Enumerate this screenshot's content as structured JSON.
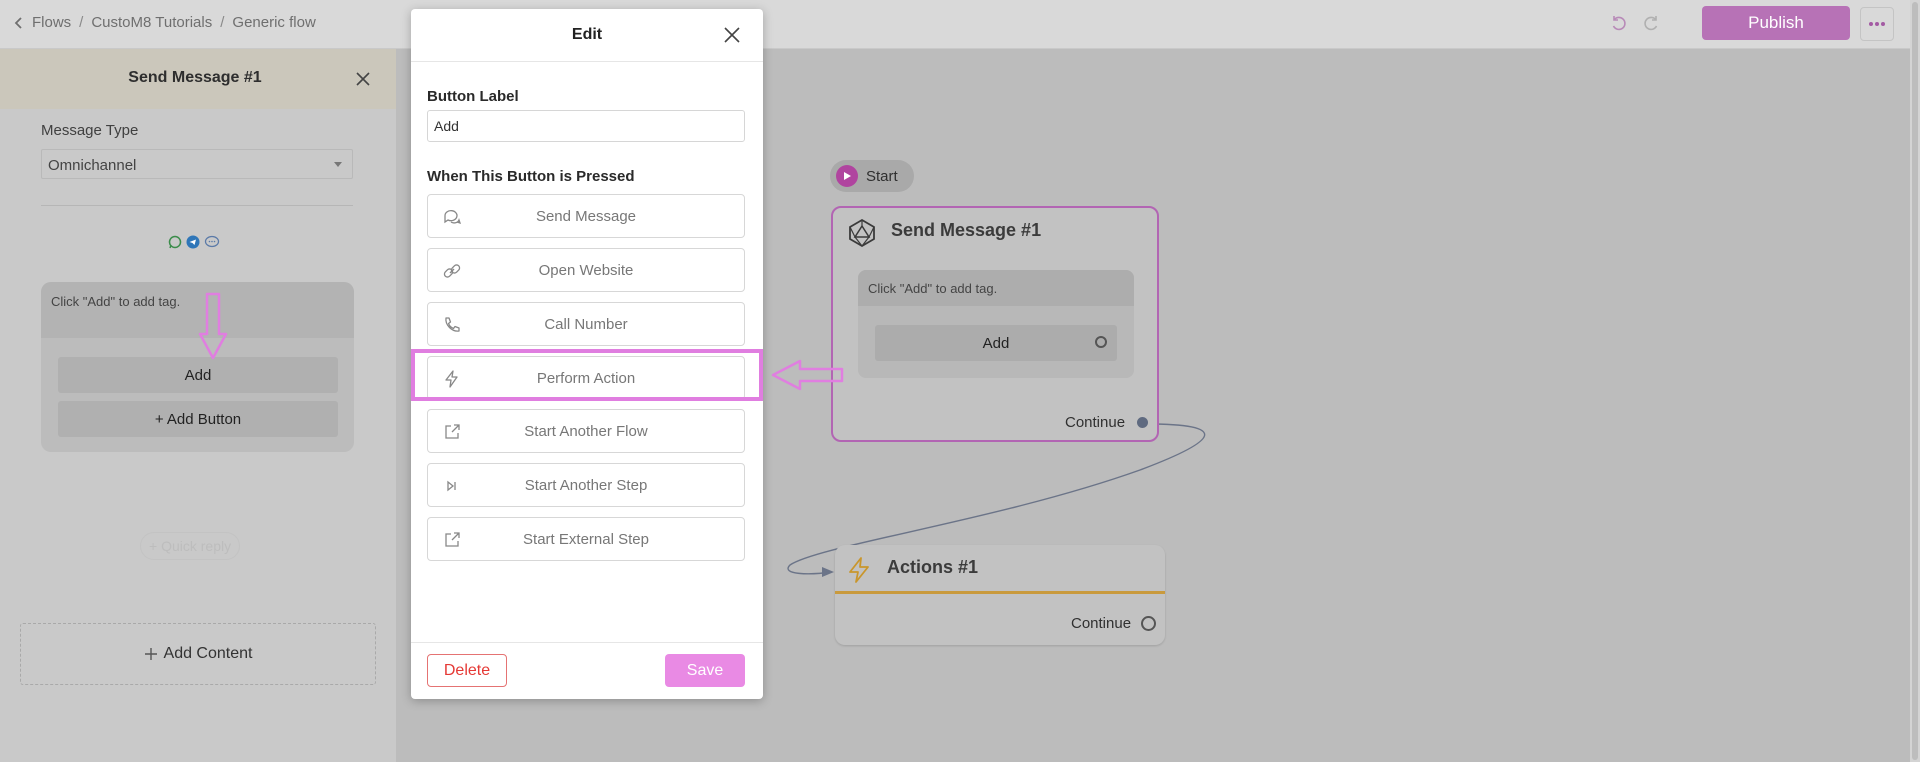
{
  "topbar": {
    "breadcrumb": [
      "Flows",
      "CustoM8 Tutorials",
      "Generic flow"
    ],
    "publish_label": "Publish"
  },
  "left_panel": {
    "title": "Send Message #1",
    "message_type_label": "Message Type",
    "message_type_value": "Omnichannel",
    "channel_icons": [
      "whatsapp-icon",
      "telegram-icon",
      "chat-bubble-icon"
    ],
    "card_text": "Click \"Add\" to add tag.",
    "add_button_label": "Add",
    "add_button_action_label": "+ Add Button",
    "quick_reply_label": "+ Quick reply",
    "add_content_label": "Add Content"
  },
  "modal": {
    "title": "Edit",
    "button_label_heading": "Button Label",
    "button_label_value": "Add",
    "when_pressed_heading": "When This Button is Pressed",
    "actions": [
      {
        "label": "Send Message",
        "icon": "chat-icon"
      },
      {
        "label": "Open Website",
        "icon": "link-icon"
      },
      {
        "label": "Call Number",
        "icon": "phone-icon"
      },
      {
        "label": "Perform Action",
        "icon": "lightning-icon"
      },
      {
        "label": "Start Another Flow",
        "icon": "external-link-icon"
      },
      {
        "label": "Start Another Step",
        "icon": "skip-forward-icon"
      },
      {
        "label": "Start External Step",
        "icon": "external-link-icon"
      }
    ],
    "delete_label": "Delete",
    "save_label": "Save"
  },
  "canvas": {
    "start_label": "Start",
    "send_node": {
      "title": "Send Message #1",
      "text": "Click \"Add\" to add tag.",
      "button_label": "Add",
      "continue_label": "Continue"
    },
    "actions_node": {
      "title": "Actions #1",
      "continue_label": "Continue"
    }
  },
  "colors": {
    "accent": "#b772b6",
    "highlight": "#e07ee0",
    "save": "#e98ae4",
    "delete": "#e53935"
  }
}
